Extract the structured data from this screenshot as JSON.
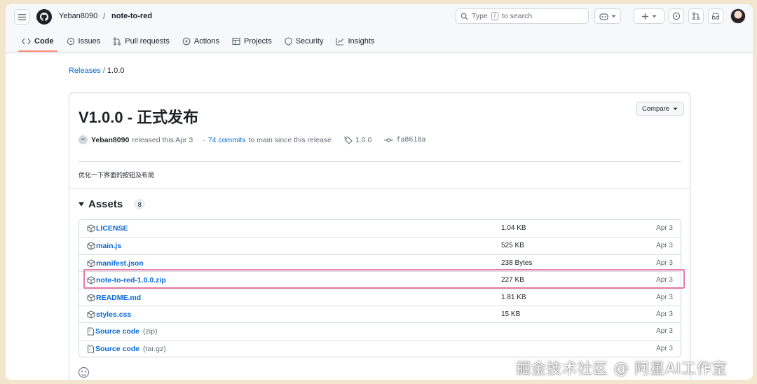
{
  "header": {
    "owner": "Yeban8090",
    "separator": "/",
    "repo": "note-to-red",
    "search_prefix": "Type",
    "search_key": "/",
    "search_suffix": "to search"
  },
  "tabs": [
    {
      "label": "Code",
      "icon": "code-icon",
      "active": true
    },
    {
      "label": "Issues",
      "icon": "issue-icon"
    },
    {
      "label": "Pull requests",
      "icon": "pull-request-icon"
    },
    {
      "label": "Actions",
      "icon": "play-icon"
    },
    {
      "label": "Projects",
      "icon": "table-icon"
    },
    {
      "label": "Security",
      "icon": "shield-icon"
    },
    {
      "label": "Insights",
      "icon": "graph-icon"
    }
  ],
  "breadcrumb": {
    "releases": "Releases",
    "sep": "/",
    "version": "1.0.0"
  },
  "release": {
    "title": "V1.0.0 - 正式发布",
    "compare_label": "Compare",
    "author": "Yeban8090",
    "released_text": "released this Apr 3",
    "dot": "·",
    "commits_link": "74 commits",
    "commits_suffix": "to main since this release",
    "tag": "1.0.0",
    "commit_sha": "fa8618a",
    "notes": "优化一下界面的按钮及布局"
  },
  "assets": {
    "title": "Assets",
    "count": "8",
    "items": [
      {
        "name": "LICENSE",
        "size": "1.04 KB",
        "date": "Apr 3"
      },
      {
        "name": "main.js",
        "size": "525 KB",
        "date": "Apr 3"
      },
      {
        "name": "manifest.json",
        "size": "238 Bytes",
        "date": "Apr 3"
      },
      {
        "name": "note-to-red-1.0.0.zip",
        "size": "227 KB",
        "date": "Apr 3",
        "highlighted": true
      },
      {
        "name": "README.md",
        "size": "1.81 KB",
        "date": "Apr 3"
      },
      {
        "name": "styles.css",
        "size": "15 KB",
        "date": "Apr 3"
      },
      {
        "name": "Source code",
        "suffix": "(zip)",
        "size": "",
        "date": "Apr 3"
      },
      {
        "name": "Source code",
        "suffix": "(tar.gz)",
        "size": "",
        "date": "Apr 3"
      }
    ]
  },
  "watermark": "掘金技术社区 @ 阿星AI工作室",
  "colors": {
    "accent_tab": "#fd8c73",
    "link": "#0969da",
    "highlight": "#e87aa8"
  }
}
